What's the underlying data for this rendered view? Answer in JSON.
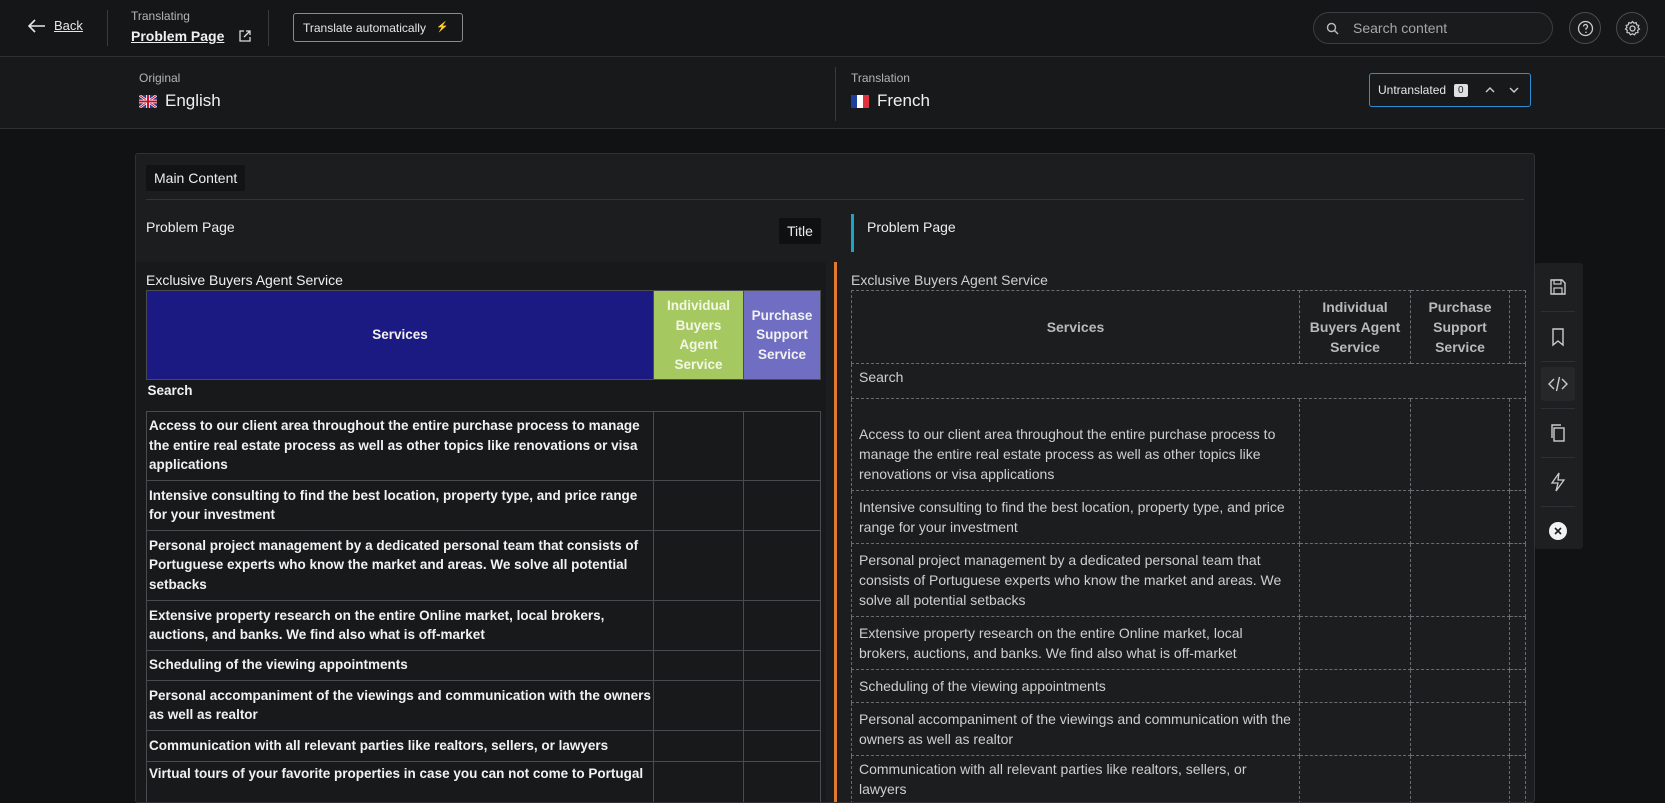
{
  "topbar": {
    "back_label": "Back",
    "translating_label": "Translating",
    "page_name": "Problem Page",
    "auto_translate_label": "Translate automatically",
    "search_placeholder": "Search content"
  },
  "languages": {
    "original_label": "Original",
    "original_name": "English",
    "translation_label": "Translation",
    "translation_name": "French",
    "untranslated_label": "Untranslated",
    "untranslated_count": "0"
  },
  "panel": {
    "section_tag": "Main Content",
    "title_row": {
      "source": "Problem Page",
      "field_badge": "Title",
      "target": "Problem Page"
    },
    "content_label_source": "Exclusive Buyers Agent Service",
    "content_label_target": "Exclusive Buyers Agent Service",
    "table_headers": [
      "Services",
      "Individual Buyers Agent Service",
      "Purchase Support Service"
    ],
    "search_row": "Search",
    "rows": [
      "Access to our client area throughout the entire purchase process to manage the entire real estate process as well as other topics like renovations or visa applications",
      "Intensive consulting to find the best location, property type, and price range for your investment",
      "Personal project management by a dedicated personal team that consists of Portuguese experts who know the market and areas. We solve all potential setbacks",
      "Extensive property research on the entire Online market, local brokers, auctions, and banks. We find also what is off-market",
      "Scheduling of the viewing appointments",
      "Personal accompaniment of the viewings and communication with the owners as well as realtor",
      "Communication with all relevant parties like realtors, sellers, or lawyers",
      "Virtual tours of your favorite properties in case you can not come to Portugal"
    ]
  },
  "colors": {
    "services_header": "#1a1a82",
    "individual_header": "#a6c860",
    "purchase_header": "#6f6ec2",
    "source_accent": "#1fa3c2",
    "target_accent": "#e07a2f",
    "untranslated_border": "#2d8fd3"
  },
  "sidebar_icons": [
    "save-icon",
    "bookmark-icon",
    "code-icon",
    "copy-icon",
    "lightning-icon",
    "close-circle-icon"
  ]
}
